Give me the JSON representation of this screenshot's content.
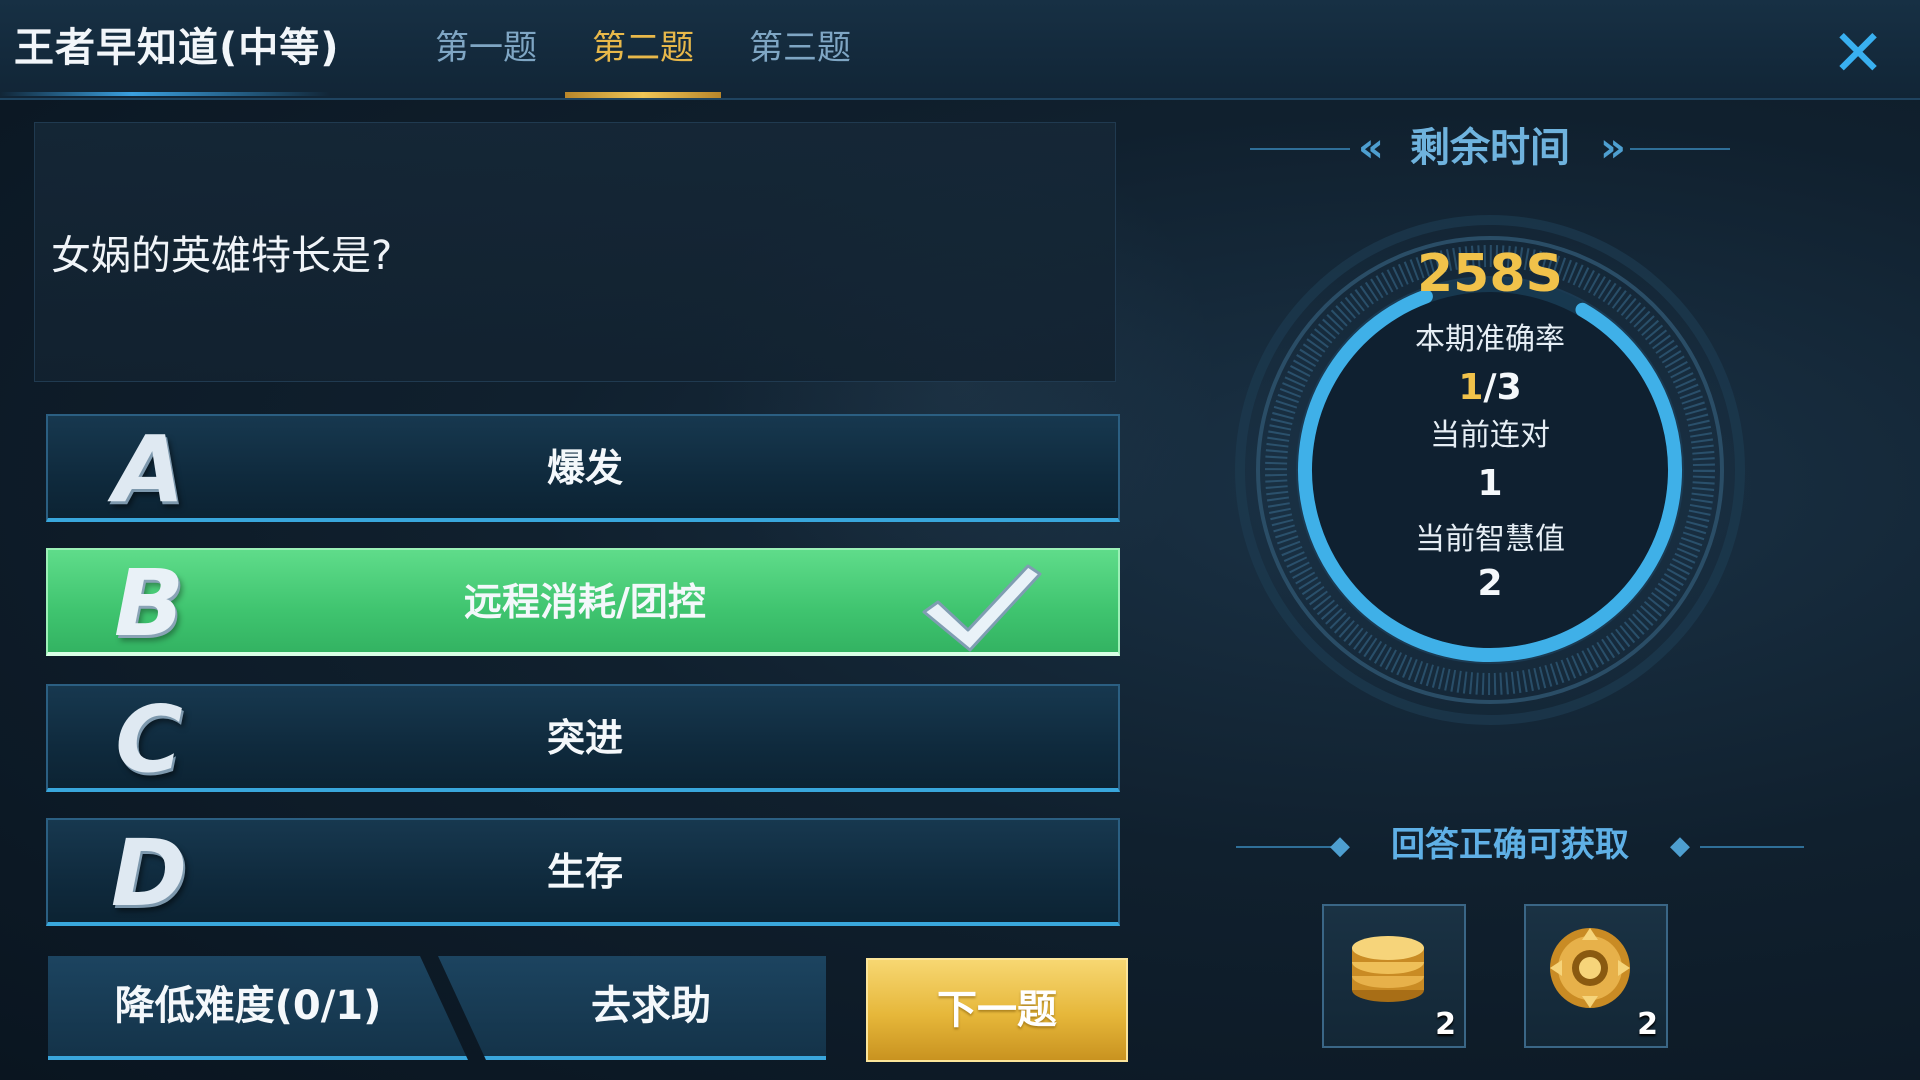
{
  "header": {
    "title": "王者早知道(中等)",
    "tabs": [
      {
        "label": "第一题",
        "active": false
      },
      {
        "label": "第二题",
        "active": true
      },
      {
        "label": "第三题",
        "active": false
      }
    ],
    "close_icon": "close-x-icon"
  },
  "question": {
    "text": "女娲的英雄特长是?"
  },
  "options": [
    {
      "letter": "A",
      "label": "爆发",
      "state": "normal"
    },
    {
      "letter": "B",
      "label": "远程消耗/团控",
      "state": "correct"
    },
    {
      "letter": "C",
      "label": "突进",
      "state": "normal"
    },
    {
      "letter": "D",
      "label": "生存",
      "state": "normal"
    }
  ],
  "buttons": {
    "lower_difficulty": "降低难度(0/1)",
    "ask_help": "去求助",
    "next": "下一题"
  },
  "timer": {
    "title": "剩余时间",
    "remaining": "258S",
    "remaining_fraction": 0.86
  },
  "stats": {
    "accuracy_label": "本期准确率",
    "accuracy_correct": "1",
    "accuracy_total": "/3",
    "streak_label": "当前连对",
    "streak_value": "1",
    "wisdom_label": "当前智慧值",
    "wisdom_value": "2"
  },
  "rewards": {
    "title": "回答正确可获取",
    "items": [
      {
        "icon": "coin-stack-icon",
        "count": "2"
      },
      {
        "icon": "gold-token-icon",
        "count": "2"
      }
    ]
  },
  "colors": {
    "accent_gold": "#f1c24a",
    "accent_blue": "#39a7dc",
    "correct_green": "#3fc46f"
  }
}
